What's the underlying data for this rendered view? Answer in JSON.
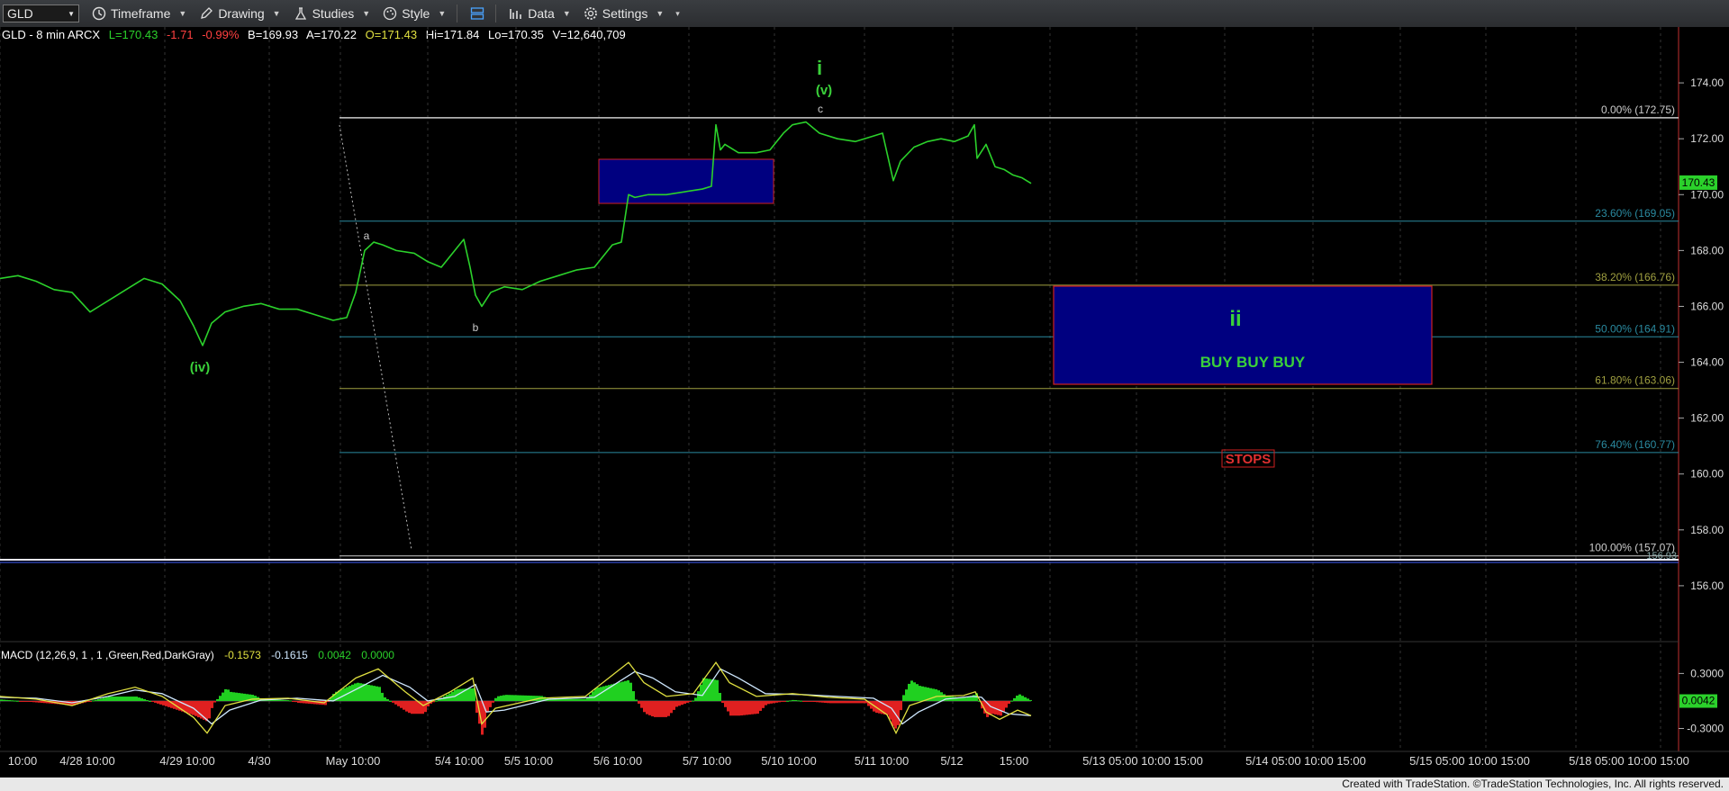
{
  "toolbar": {
    "symbol": "GLD",
    "timeframe": "Timeframe",
    "drawing": "Drawing",
    "studies": "Studies",
    "style": "Style",
    "data": "Data",
    "settings": "Settings"
  },
  "header": {
    "symbol_info": "GLD - 8 min  ARCX",
    "last": "L=170.43",
    "change": "-1.71",
    "change_pct": "-0.99%",
    "bid": "B=169.93",
    "ask": "A=170.22",
    "open": "O=171.43",
    "high": "Hi=171.84",
    "low": "Lo=170.35",
    "volume": "V=12,640,709"
  },
  "colors": {
    "price": "#2bd12b",
    "green_label": "#3ad13a",
    "fib_blue": "#2a8aa0",
    "fib_olive": "#a0a040",
    "box_fill": "#000080",
    "box_border": "#d02020",
    "stops": "#e03030",
    "macd_line": "#e0e040",
    "signal_line": "#cfe8ff",
    "hist_pos": "#20d020",
    "hist_neg": "#e02020"
  },
  "chart_data": {
    "type": "line",
    "ylim": [
      154,
      176
    ],
    "y_ticks": [
      "174.00",
      "172.00",
      "170.00",
      "168.00",
      "166.00",
      "164.00",
      "162.00",
      "160.00",
      "158.00",
      "156.00"
    ],
    "y_tick_values": [
      174,
      172,
      170,
      168,
      166,
      164,
      162,
      160,
      158,
      156
    ],
    "last_price_label": "170.43",
    "last_price": 170.43,
    "x_labels": [
      "10:00",
      "4/28 10:00",
      "4/29 10:00",
      "4/30",
      "May 10:00",
      "5/4 10:00",
      "5/5 10:00",
      "5/6 10:00",
      "5/7 10:00",
      "5/10 10:00",
      "5/11 10:00",
      "5/12",
      "15:00",
      "5/13 05:00 10:00 15:00",
      "5/14 05:00 10:00 15:00",
      "5/15 05:00 10:00 15:00",
      "5/18 05:00 10:00 15:00"
    ],
    "fib_levels": [
      {
        "label": "0.00% (172.75)",
        "value": 172.75,
        "color": "#cccccc"
      },
      {
        "label": "23.60% (169.05)",
        "value": 169.05,
        "color": "#2a8aa0"
      },
      {
        "label": "38.20% (166.76)",
        "value": 166.76,
        "color": "#a0a040"
      },
      {
        "label": "50.00% (164.91)",
        "value": 164.91,
        "color": "#2a8aa0"
      },
      {
        "label": "61.80% (163.06)",
        "value": 163.06,
        "color": "#a0a040"
      },
      {
        "label": "76.40% (160.77)",
        "value": 160.77,
        "color": "#2a8aa0"
      },
      {
        "label": "100.00% (157.07)",
        "value": 157.07,
        "color": "#cccccc"
      }
    ],
    "horizontal_line_label": "156.93",
    "horizontal_line_value": 156.93,
    "price_series": [
      [
        0,
        167
      ],
      [
        20,
        167.1
      ],
      [
        40,
        166.9
      ],
      [
        60,
        166.6
      ],
      [
        80,
        166.5
      ],
      [
        100,
        165.8
      ],
      [
        120,
        166.2
      ],
      [
        140,
        166.6
      ],
      [
        160,
        167
      ],
      [
        180,
        166.8
      ],
      [
        200,
        166.2
      ],
      [
        215,
        165.3
      ],
      [
        225,
        164.6
      ],
      [
        235,
        165.4
      ],
      [
        250,
        165.8
      ],
      [
        270,
        166
      ],
      [
        290,
        166.1
      ],
      [
        310,
        165.9
      ],
      [
        330,
        165.9
      ],
      [
        350,
        165.7
      ],
      [
        370,
        165.5
      ],
      [
        385,
        165.6
      ],
      [
        395,
        166.5
      ],
      [
        405,
        168
      ],
      [
        415,
        168.3
      ],
      [
        425,
        168.2
      ],
      [
        440,
        168
      ],
      [
        460,
        167.9
      ],
      [
        475,
        167.6
      ],
      [
        490,
        167.4
      ],
      [
        505,
        168
      ],
      [
        515,
        168.4
      ],
      [
        522,
        167.4
      ],
      [
        528,
        166.4
      ],
      [
        535,
        166
      ],
      [
        545,
        166.5
      ],
      [
        560,
        166.7
      ],
      [
        580,
        166.6
      ],
      [
        600,
        166.9
      ],
      [
        620,
        167.1
      ],
      [
        640,
        167.3
      ],
      [
        660,
        167.4
      ],
      [
        680,
        168.2
      ],
      [
        690,
        168.3
      ],
      [
        698,
        170
      ],
      [
        705,
        169.9
      ],
      [
        720,
        170
      ],
      [
        740,
        170
      ],
      [
        760,
        170.1
      ],
      [
        780,
        170.2
      ],
      [
        790,
        170.3
      ],
      [
        795,
        172.5
      ],
      [
        800,
        171.6
      ],
      [
        805,
        171.8
      ],
      [
        820,
        171.5
      ],
      [
        840,
        171.5
      ],
      [
        855,
        171.6
      ],
      [
        870,
        172.2
      ],
      [
        880,
        172.5
      ],
      [
        895,
        172.6
      ],
      [
        910,
        172.2
      ],
      [
        930,
        172
      ],
      [
        950,
        171.9
      ],
      [
        970,
        172.1
      ],
      [
        980,
        172.2
      ],
      [
        992,
        170.5
      ],
      [
        1000,
        171.2
      ],
      [
        1015,
        171.7
      ],
      [
        1030,
        171.9
      ],
      [
        1045,
        172
      ],
      [
        1060,
        171.9
      ],
      [
        1075,
        172.1
      ],
      [
        1082,
        172.5
      ],
      [
        1085,
        171.3
      ],
      [
        1095,
        171.8
      ],
      [
        1105,
        171
      ],
      [
        1115,
        170.9
      ],
      [
        1125,
        170.7
      ],
      [
        1135,
        170.6
      ],
      [
        1145,
        170.4
      ]
    ],
    "macd": {
      "label": "MACD (12,26,9, 1 , 1 ,Green,Red,DarkGray)",
      "v1": "-0.1573",
      "v2": "-0.1615",
      "v3": "0.0042",
      "v4": "0.0000",
      "y_ticks": [
        "0.3000",
        "-0.3000"
      ],
      "y_tick_values": [
        0.3,
        -0.3
      ],
      "last_value_label": "0.0042",
      "ylim": [
        -0.55,
        0.5
      ],
      "macd_series": [
        [
          0,
          0.05
        ],
        [
          40,
          0.02
        ],
        [
          80,
          -0.05
        ],
        [
          120,
          0.08
        ],
        [
          150,
          0.15
        ],
        [
          180,
          0.05
        ],
        [
          215,
          -0.18
        ],
        [
          230,
          -0.35
        ],
        [
          250,
          -0.05
        ],
        [
          280,
          0.02
        ],
        [
          320,
          0.03
        ],
        [
          360,
          -0.02
        ],
        [
          395,
          0.25
        ],
        [
          420,
          0.35
        ],
        [
          450,
          0.1
        ],
        [
          470,
          -0.05
        ],
        [
          500,
          0.1
        ],
        [
          525,
          0.25
        ],
        [
          535,
          -0.25
        ],
        [
          550,
          -0.08
        ],
        [
          600,
          0.03
        ],
        [
          650,
          0.05
        ],
        [
          698,
          0.42
        ],
        [
          715,
          0.2
        ],
        [
          740,
          0.05
        ],
        [
          770,
          0.08
        ],
        [
          795,
          0.42
        ],
        [
          810,
          0.2
        ],
        [
          840,
          0.05
        ],
        [
          880,
          0.08
        ],
        [
          920,
          0.04
        ],
        [
          960,
          0.02
        ],
        [
          985,
          -0.15
        ],
        [
          995,
          -0.35
        ],
        [
          1010,
          -0.05
        ],
        [
          1040,
          0.05
        ],
        [
          1070,
          0.06
        ],
        [
          1083,
          0.1
        ],
        [
          1095,
          -0.12
        ],
        [
          1110,
          -0.2
        ],
        [
          1130,
          -0.1
        ],
        [
          1145,
          -0.16
        ]
      ],
      "signal_series": [
        [
          0,
          0.04
        ],
        [
          40,
          0.03
        ],
        [
          80,
          -0.02
        ],
        [
          120,
          0.05
        ],
        [
          150,
          0.12
        ],
        [
          180,
          0.08
        ],
        [
          215,
          -0.08
        ],
        [
          235,
          -0.25
        ],
        [
          255,
          -0.1
        ],
        [
          290,
          0.01
        ],
        [
          330,
          0.03
        ],
        [
          370,
          0.0
        ],
        [
          400,
          0.15
        ],
        [
          425,
          0.28
        ],
        [
          455,
          0.15
        ],
        [
          475,
          0.0
        ],
        [
          505,
          0.05
        ],
        [
          528,
          0.18
        ],
        [
          540,
          -0.12
        ],
        [
          560,
          -0.1
        ],
        [
          610,
          0.02
        ],
        [
          660,
          0.04
        ],
        [
          705,
          0.32
        ],
        [
          725,
          0.25
        ],
        [
          750,
          0.1
        ],
        [
          780,
          0.06
        ],
        [
          800,
          0.35
        ],
        [
          820,
          0.25
        ],
        [
          850,
          0.08
        ],
        [
          890,
          0.07
        ],
        [
          930,
          0.05
        ],
        [
          970,
          0.03
        ],
        [
          990,
          -0.08
        ],
        [
          1002,
          -0.25
        ],
        [
          1020,
          -0.12
        ],
        [
          1050,
          0.02
        ],
        [
          1080,
          0.05
        ],
        [
          1090,
          0.04
        ],
        [
          1100,
          -0.06
        ],
        [
          1120,
          -0.14
        ],
        [
          1145,
          -0.16
        ]
      ]
    },
    "annotations": {
      "wave_i": "i",
      "wave_v": "(v)",
      "wave_c": "c",
      "wave_a": "a",
      "wave_b": "b",
      "wave_iv": "(iv)",
      "box_ii": "ii",
      "buy_text": "BUY BUY BUY",
      "stops_text": "STOPS"
    }
  },
  "footer": {
    "credit": "Created with TradeStation. ©TradeStation Technologies, Inc. All rights reserved."
  }
}
